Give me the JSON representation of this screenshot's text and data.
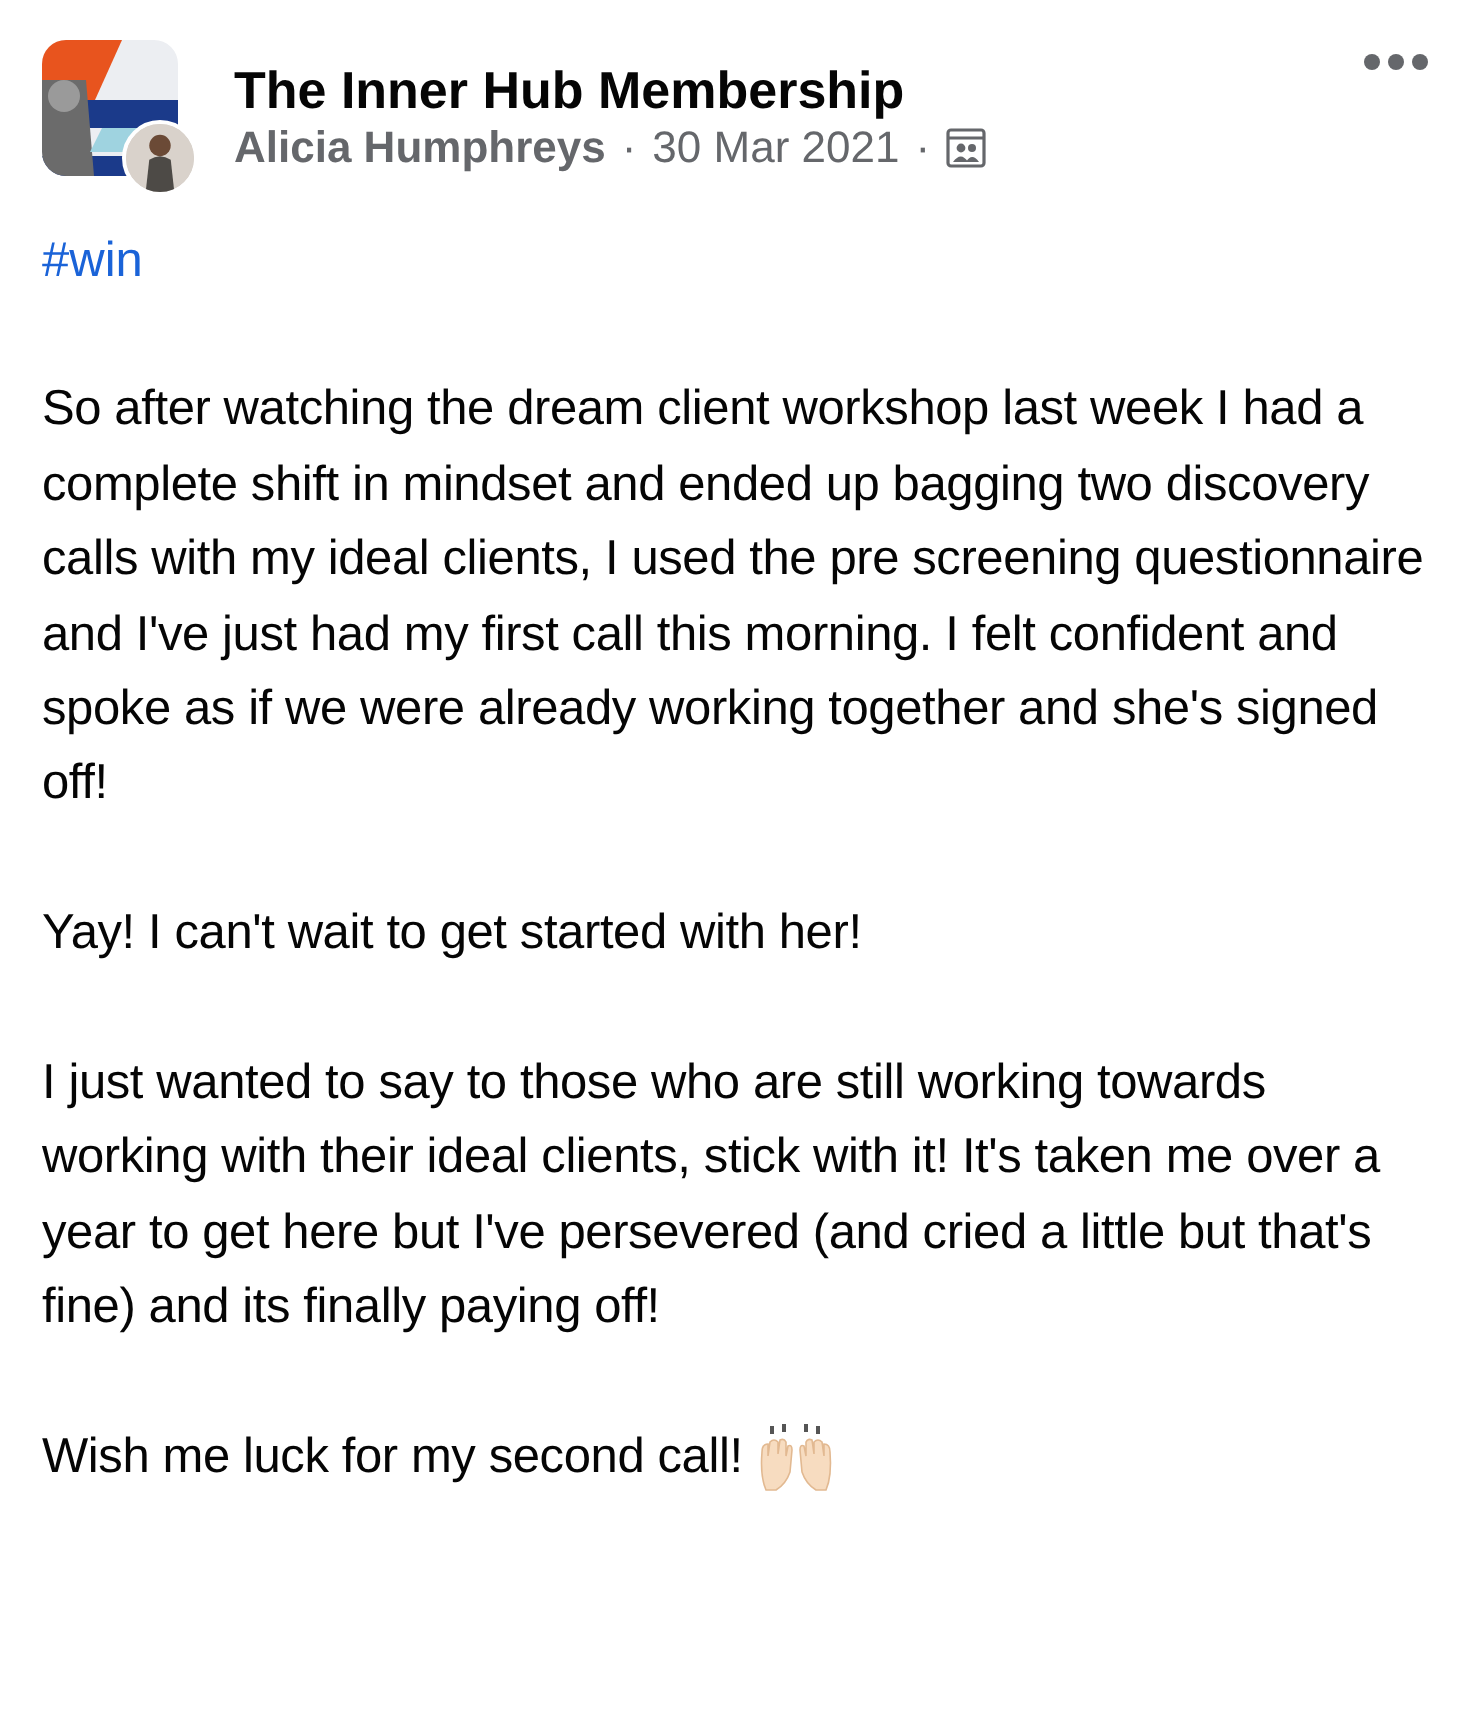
{
  "post": {
    "group": "The Inner Hub Membership",
    "author": "Alicia Humphreys",
    "separator_1": "·",
    "date": "30 Mar 2021",
    "separator_2": "·",
    "hashtag": "#win",
    "paragraphs": [
      "So after watching the dream client workshop last week I had a complete shift in mindset and ended up bagging two discovery calls with my ideal clients, I used the pre screening questionnaire and I've just had my first call this morning. I felt confident and spoke as if we were already working together and she's signed off!",
      "Yay! I can't wait to get started with her!",
      "I just wanted to say to those who are still working towards working with their ideal clients, stick with it! It's taken me over a year to get here but I've persevered (and cried a little but that's fine) and its finally paying off!",
      "Wish me luck for my second call!"
    ]
  }
}
